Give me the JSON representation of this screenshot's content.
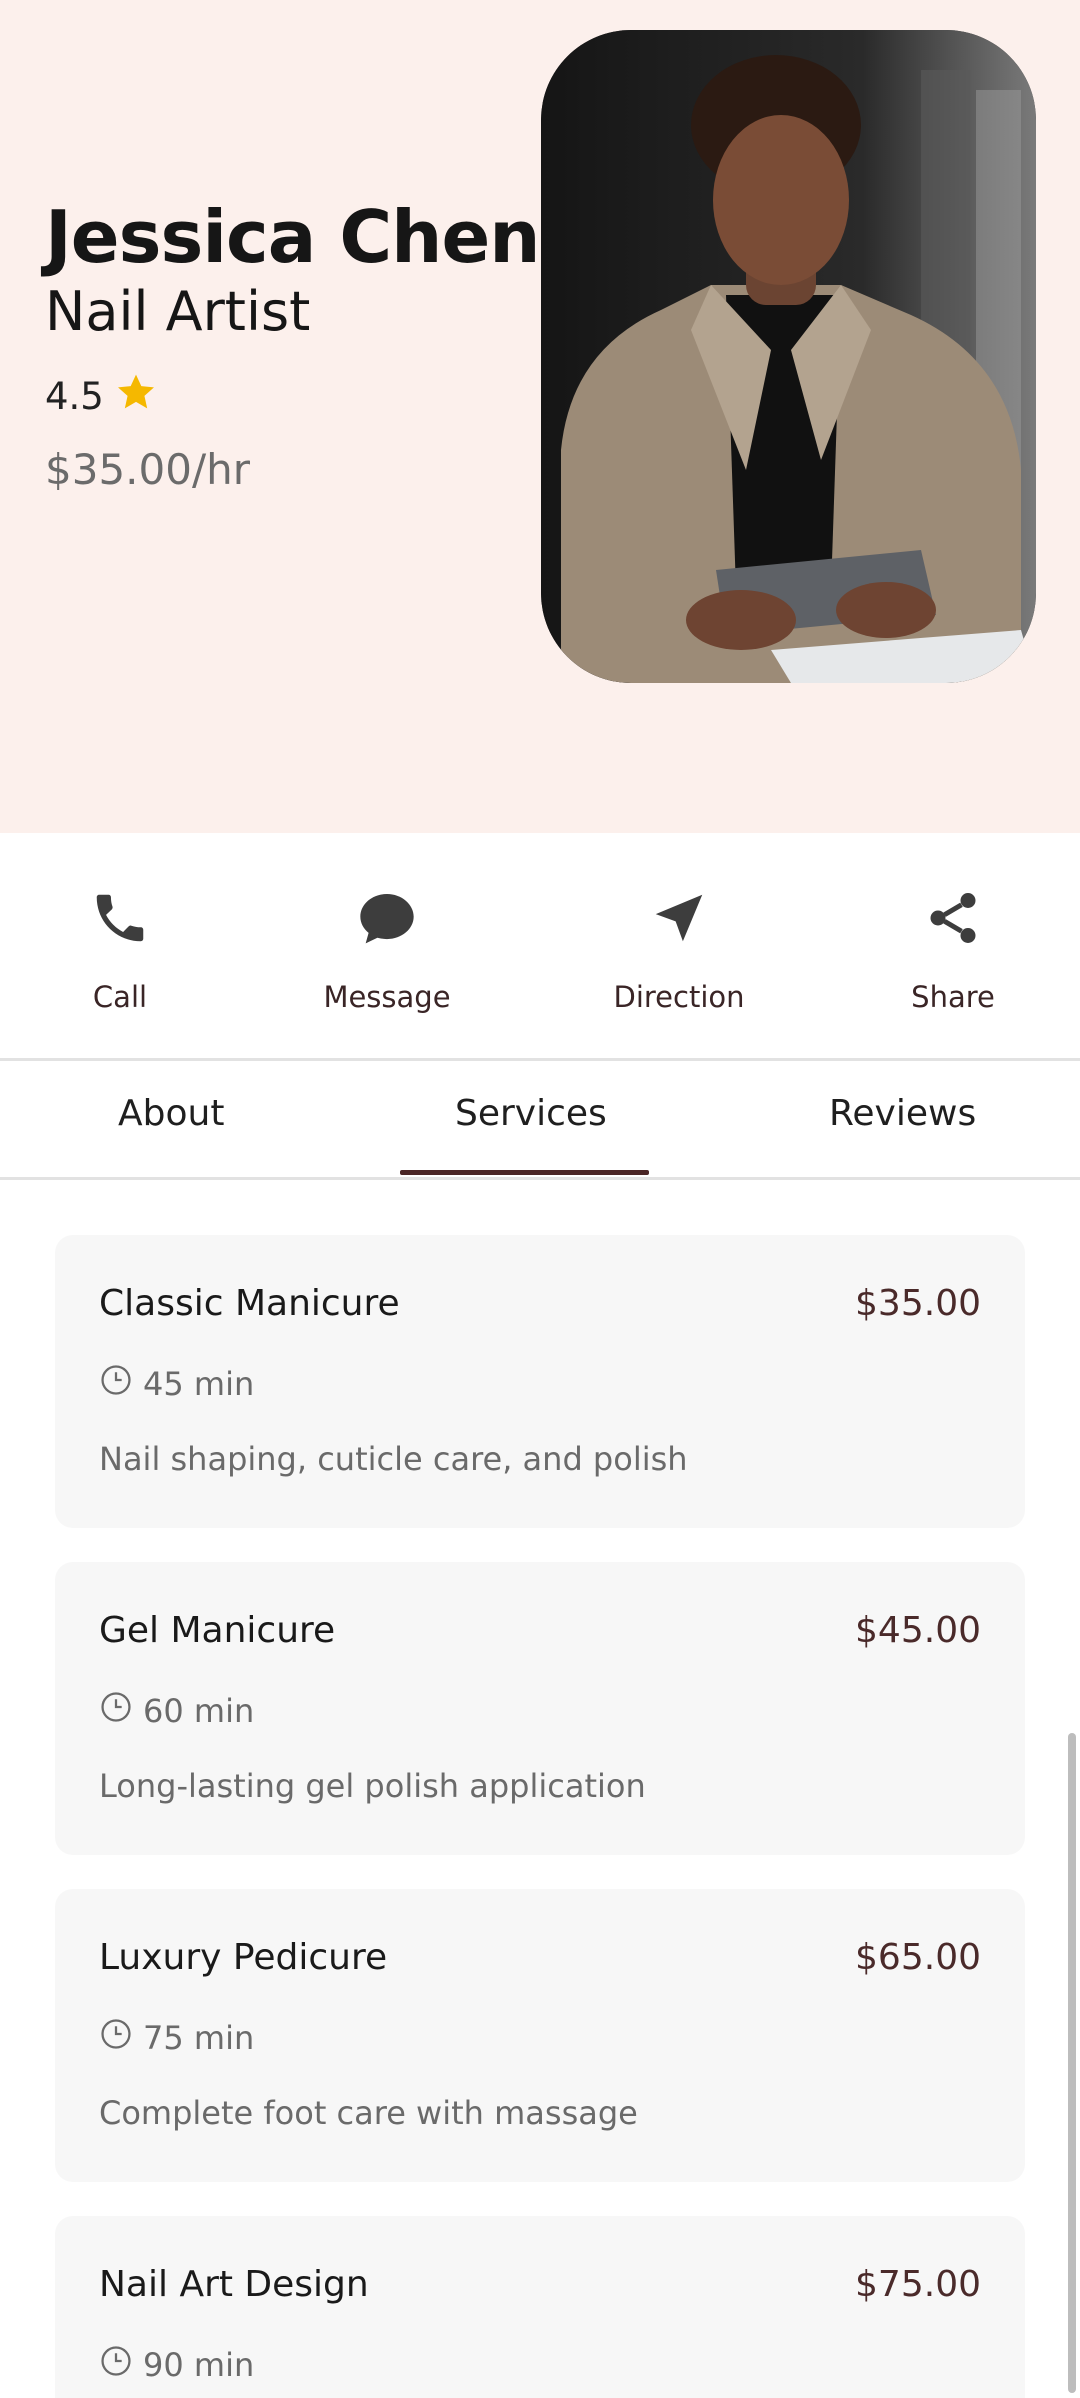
{
  "profile": {
    "name": "Jessica Chen",
    "role": "Nail Artist",
    "rating": "4.5",
    "rate": "$35.00/hr"
  },
  "actions": [
    {
      "label": "Call",
      "icon": "phone-icon"
    },
    {
      "label": "Message",
      "icon": "chat-bubble-icon"
    },
    {
      "label": "Direction",
      "icon": "navigation-arrow-icon"
    },
    {
      "label": "Share",
      "icon": "share-icon"
    }
  ],
  "tabs": [
    "About",
    "Services",
    "Reviews"
  ],
  "active_tab": "Services",
  "services": [
    {
      "title": "Classic Manicure",
      "price": "$35.00",
      "duration": "45 min",
      "description": "Nail shaping, cuticle care, and polish"
    },
    {
      "title": "Gel Manicure",
      "price": "$45.00",
      "duration": "60 min",
      "description": "Long-lasting gel polish application"
    },
    {
      "title": "Luxury Pedicure",
      "price": "$65.00",
      "duration": "75 min",
      "description": "Complete foot care with massage"
    },
    {
      "title": "Nail Art Design",
      "price": "$75.00",
      "duration": "90 min",
      "description": ""
    }
  ],
  "colors": {
    "hero_bg": "#fcf0ec",
    "accent": "#4a2525",
    "star": "#f5b800",
    "card_bg": "#f7f7f7"
  }
}
